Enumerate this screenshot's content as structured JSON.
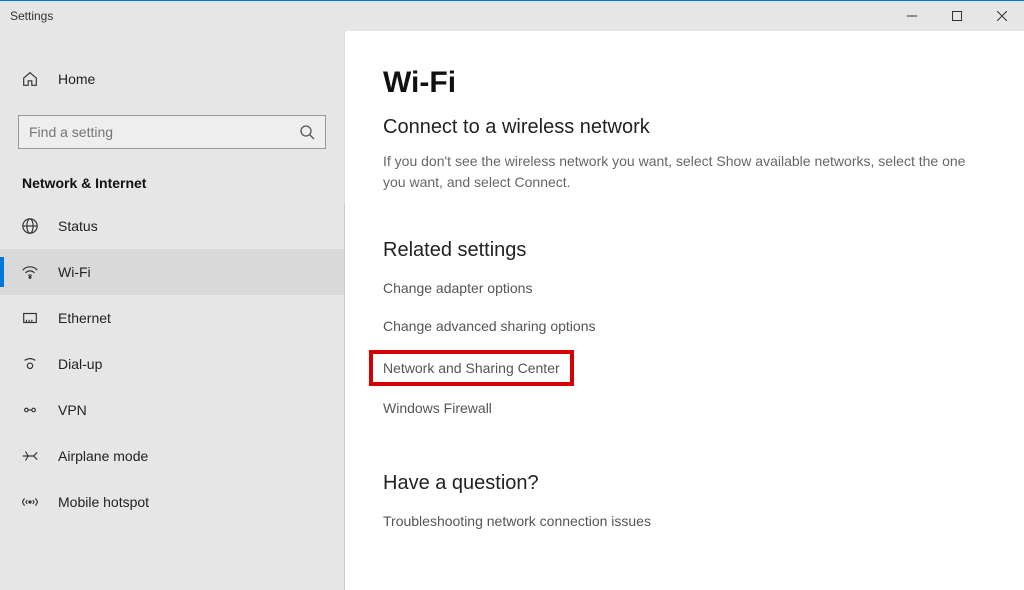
{
  "window": {
    "title": "Settings"
  },
  "sidebar": {
    "home": "Home",
    "search_placeholder": "Find a setting",
    "category": "Network & Internet",
    "items": [
      {
        "label": "Status"
      },
      {
        "label": "Wi-Fi"
      },
      {
        "label": "Ethernet"
      },
      {
        "label": "Dial-up"
      },
      {
        "label": "VPN"
      },
      {
        "label": "Airplane mode"
      },
      {
        "label": "Mobile hotspot"
      }
    ]
  },
  "main": {
    "title": "Wi-Fi",
    "subtitle": "Connect to a wireless network",
    "description": "If you don't see the wireless network you want, select Show available networks, select the one you want, and select Connect.",
    "related_heading": "Related settings",
    "related": [
      "Change adapter options",
      "Change advanced sharing options",
      "Network and Sharing Center",
      "Windows Firewall"
    ],
    "question_heading": "Have a question?",
    "question_link": "Troubleshooting network connection issues"
  }
}
